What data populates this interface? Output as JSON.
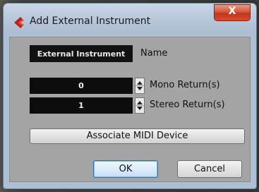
{
  "window": {
    "title": "Add External Instrument",
    "close_label": "X",
    "title_icon": "cubase-back-icon"
  },
  "form": {
    "instrument_name_value": "External Instrument",
    "name_label": "Name",
    "mono_returns_value": "0",
    "mono_returns_label": "Mono Return(s)",
    "stereo_returns_value": "1",
    "stereo_returns_label": "Stereo Return(s)"
  },
  "buttons": {
    "associate_midi": "Associate MIDI Device",
    "ok": "OK",
    "cancel": "Cancel"
  }
}
